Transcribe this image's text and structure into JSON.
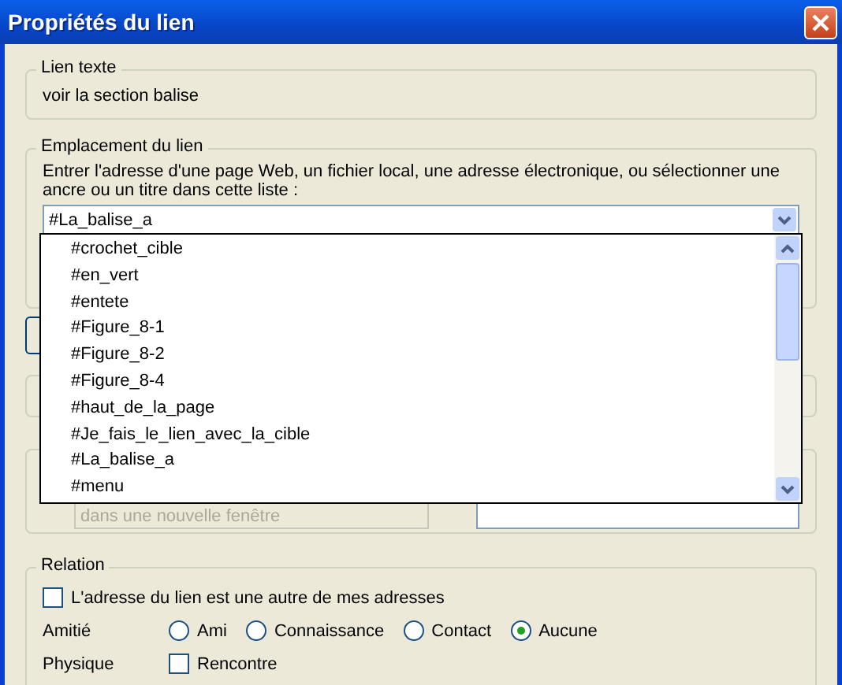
{
  "window": {
    "title": "Propriétés du lien"
  },
  "link_text": {
    "legend": "Lien texte",
    "value": "voir la section balise"
  },
  "location": {
    "legend": "Emplacement du lien",
    "description": "Entrer l'adresse d'une page Web, un fichier local, une adresse électronique, ou sélectionner une ancre ou un titre dans cette liste :",
    "value": "#La_balise_a",
    "dropdown_items": [
      "#crochet_cible",
      "#en_vert",
      "#entete",
      "#Figure_8-1",
      "#Figure_8-2",
      "#Figure_8-4",
      "#haut_de_la_page",
      "#Je_fais_le_lien_avec_la_cible",
      "#La_balise_a",
      "#menu"
    ]
  },
  "target": {
    "value": "dans une nouvelle fenêtre",
    "disabled": true
  },
  "relation": {
    "legend": "Relation",
    "checkbox": {
      "label": "L'adresse du lien est une autre de mes adresses",
      "checked": false
    },
    "rows": [
      {
        "label": "Amitié",
        "kind": "radio",
        "options": [
          {
            "label": "Ami",
            "selected": false
          },
          {
            "label": "Connaissance",
            "selected": false
          },
          {
            "label": "Contact",
            "selected": false
          },
          {
            "label": "Aucune",
            "selected": true
          }
        ]
      },
      {
        "label": "Physique",
        "kind": "checkbox",
        "options": [
          {
            "label": "Rencontre",
            "checked": false
          }
        ]
      }
    ]
  }
}
